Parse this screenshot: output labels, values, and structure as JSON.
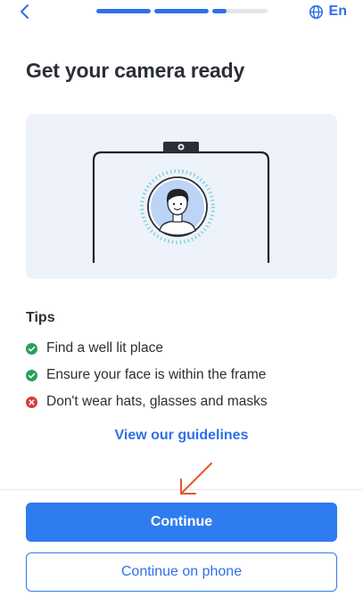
{
  "header": {
    "back_icon": "chevron-left-icon",
    "progress_steps": [
      1,
      1,
      0.25,
      0
    ],
    "language_icon": "globe-icon",
    "language_label": "En"
  },
  "title": "Get your camera ready",
  "illustration": {
    "icons": [
      "laptop-frame-icon",
      "webcam-icon",
      "face-avatar-icon"
    ]
  },
  "tips": {
    "title": "Tips",
    "items": [
      {
        "label": "Find a well lit place",
        "status": "ok",
        "icon": "check-circle-icon"
      },
      {
        "label": "Ensure your face is within the frame",
        "status": "ok",
        "icon": "check-circle-icon"
      },
      {
        "label": "Don't wear hats, glasses and masks",
        "status": "error",
        "icon": "cross-circle-icon"
      }
    ]
  },
  "guidelines_link": "View our guidelines",
  "buttons": {
    "continue": "Continue",
    "continue_on_phone": "Continue on phone"
  },
  "colors": {
    "accent": "#2f6fe8",
    "primary_button": "#2f7cf0",
    "success": "#27a05a",
    "error": "#d93a3a",
    "illustration_bg": "#eef2fa",
    "annotation_arrow": "#e2562b"
  }
}
